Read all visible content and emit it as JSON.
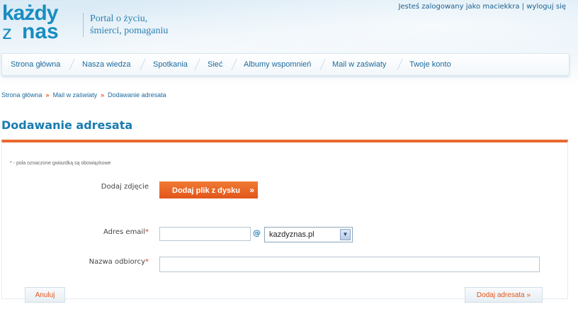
{
  "header": {
    "logo_line1": "każdy",
    "logo_line2a": "z",
    "logo_line2b": "nas",
    "tagline_line1": "Portal o życiu,",
    "tagline_line2": "śmierci, pomaganiu",
    "user_status": "Jesteś zalogowany jako maciekkra",
    "logout_link": "wyloguj się",
    "separator": "|"
  },
  "nav": {
    "items": [
      {
        "label": "Strona główna"
      },
      {
        "label": "Nasza wiedza"
      },
      {
        "label": "Spotkania"
      },
      {
        "label": "Sieć"
      },
      {
        "label": "Albumy wspomnień"
      },
      {
        "label": "Mail w zaświaty"
      },
      {
        "label": "Twoje konto"
      }
    ]
  },
  "breadcrumb": {
    "items": [
      "Strona główna",
      "Mail w zaświaty",
      "Dodawanie adresata"
    ],
    "separator": "»"
  },
  "page": {
    "title": "Dodawanie adresata"
  },
  "form": {
    "required_note": "* - pola oznaczone gwiazdką są obowiązkowe",
    "photo_label": "Dodaj zdjęcie",
    "upload_button": "Dodaj plik z dysku",
    "upload_arrow": "»",
    "email_label": "Adres email",
    "email_value": "",
    "at_sign": "@",
    "domain_selected": "kazdyznas.pl",
    "name_label": "Nazwa odbiorcy",
    "name_value": "",
    "required_star": "*",
    "cancel_button": "Anuluj",
    "submit_button": "Dodaj adresata »"
  },
  "colors": {
    "brand_blue": "#1a8cc0",
    "accent_orange": "#e8692f"
  }
}
